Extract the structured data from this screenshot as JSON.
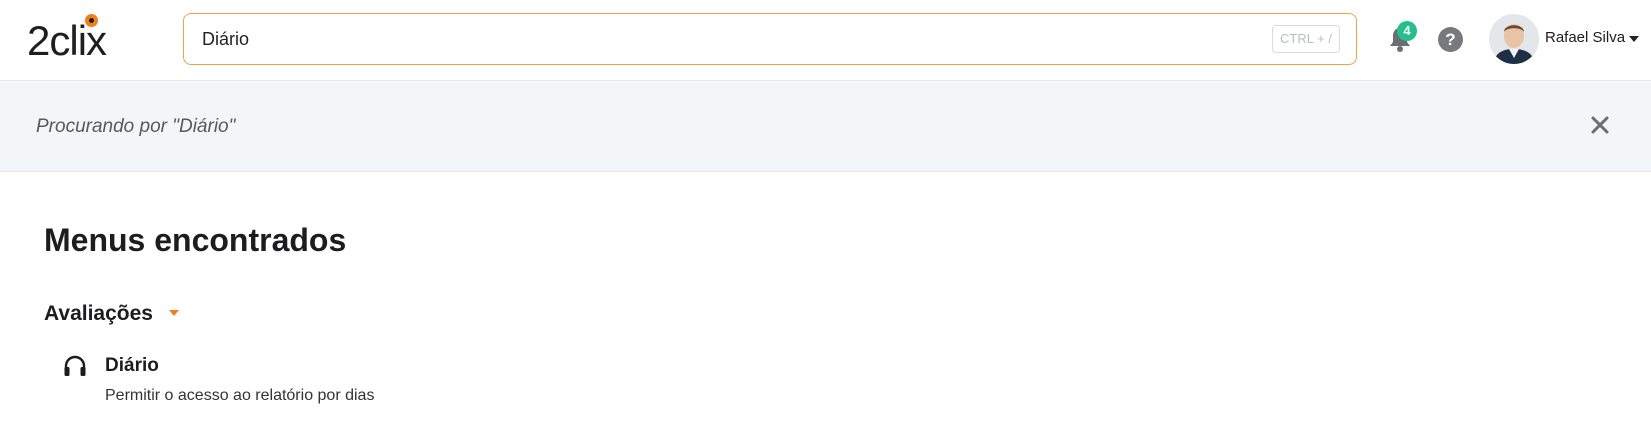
{
  "header": {
    "logo_text": "2clix",
    "search": {
      "value": "Diário",
      "shortcut": "CTRL + /"
    },
    "notifications": {
      "count": "4",
      "icon": "bell-icon"
    },
    "help": {
      "label": "?",
      "icon": "help-icon"
    },
    "user": {
      "name": "Rafael Silva"
    }
  },
  "banner": {
    "text": "Procurando por \"Diário\"",
    "close_icon": "close-icon"
  },
  "results": {
    "title": "Menus encontrados",
    "groups": [
      {
        "label": "Avaliações",
        "items": [
          {
            "icon": "headphones-icon",
            "title": "Diário",
            "description": "Permitir o acesso ao relatório por dias"
          }
        ]
      }
    ]
  },
  "colors": {
    "accent": "#f07e1b",
    "badge": "#25c08a",
    "banner_bg": "#f3f6f9"
  }
}
